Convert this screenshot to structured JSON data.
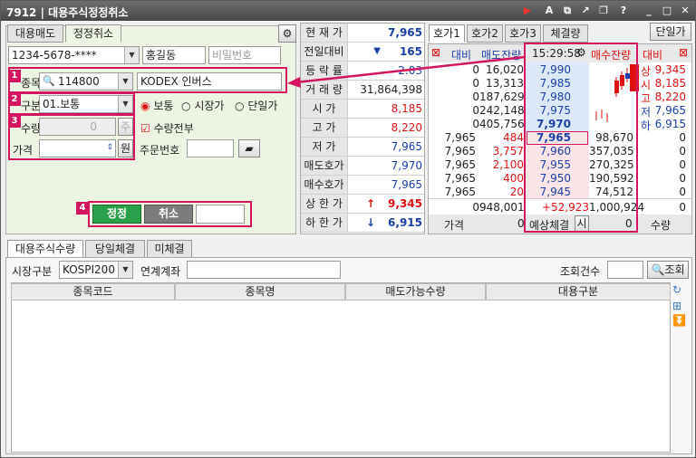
{
  "window": {
    "code": "7912",
    "title": "대용주식정정취소"
  },
  "tabs_left": [
    "대용매도",
    "정정취소"
  ],
  "account": {
    "number": "1234-5678-****",
    "name": "홍길동",
    "password_placeholder": "비밀번호"
  },
  "order": {
    "stock_label": "종목",
    "stock_code": "114800",
    "stock_name": "KODEX 인버스",
    "type_label": "구분",
    "type_value": "01.보통",
    "radios": [
      "보통",
      "시장가",
      "단일가"
    ],
    "qty_label": "수량",
    "qty_value": "0",
    "qty_unit": "주",
    "all_qty_label": "수량전부",
    "price_label": "가격",
    "price_unit": "원",
    "order_no_label": "주문번호",
    "modify_label": "정정",
    "cancel_label": "취소"
  },
  "badges": [
    "1",
    "2",
    "3",
    "4"
  ],
  "quote": [
    {
      "k": "현 재 가",
      "v": "7,965"
    },
    {
      "k": "전일대비",
      "v": "165",
      "arrow": "▼"
    },
    {
      "k": "등 락 률",
      "v": "-2.03"
    },
    {
      "k": "거 래 량",
      "v": "31,864,398"
    },
    {
      "k": "시   가",
      "v": "8,185"
    },
    {
      "k": "고   가",
      "v": "8,220"
    },
    {
      "k": "저   가",
      "v": "7,965"
    },
    {
      "k": "매도호가",
      "v": "7,970"
    },
    {
      "k": "매수호가",
      "v": "7,965"
    },
    {
      "k": "상 한 가",
      "v": "9,345",
      "arrow": "↑"
    },
    {
      "k": "하 한 가",
      "v": "6,915",
      "arrow": "↓"
    }
  ],
  "tabs_right": [
    "호가1",
    "호가2",
    "호가3",
    "체결량"
  ],
  "single_price_btn": "단일가",
  "orderbook": {
    "hdr_left": "대비",
    "hdr_ask": "매도잔량",
    "time": "15:29:58",
    "hdr_bid": "매수잔량",
    "hdr_right": "대비",
    "ask_rows": [
      {
        "a": "0",
        "b": "16,020",
        "p": "7,990"
      },
      {
        "a": "0",
        "b": "13,313",
        "p": "7,985"
      },
      {
        "a": "0",
        "b": "187,629",
        "p": "7,980"
      },
      {
        "a": "0",
        "b": "242,148",
        "p": "7,975"
      },
      {
        "a": "0",
        "b": "405,756",
        "p": "7,970"
      }
    ],
    "bid_rows": [
      {
        "l": "7,965",
        "c": "484",
        "p": "7,965",
        "b": "98,670",
        "r": "0"
      },
      {
        "l": "7,965",
        "c": "3,757",
        "p": "7,960",
        "b": "357,035",
        "r": "0"
      },
      {
        "l": "7,965",
        "c": "2,100",
        "p": "7,955",
        "b": "270,325",
        "r": "0"
      },
      {
        "l": "7,965",
        "c": "400",
        "p": "7,950",
        "b": "190,592",
        "r": "0"
      },
      {
        "l": "7,965",
        "c": "20",
        "p": "7,945",
        "b": "74,512",
        "r": "0"
      }
    ],
    "side_labels": [
      {
        "k": "상",
        "v": "9,345"
      },
      {
        "k": "시",
        "v": "8,185"
      },
      {
        "k": "고",
        "v": "8,220"
      },
      {
        "k": "저",
        "v": "7,965"
      },
      {
        "k": "하",
        "v": "6,915"
      }
    ],
    "tot_left": "0",
    "tot_ask": "948,001",
    "tot_diff": "+52,923",
    "tot_bid": "1,000,924",
    "tot_right": "0",
    "foot_price": "가격",
    "foot_zero": "0",
    "foot_expect": "예상체결",
    "foot_si": "시",
    "foot_zero2": "0",
    "foot_qty": "수량"
  },
  "tabs_bottom": [
    "대용주식수량",
    "당일체결",
    "미체결"
  ],
  "filter": {
    "market_label": "시장구분",
    "market_value": "KOSPI200",
    "link_label": "연계계좌",
    "count_label": "조회건수",
    "search_label": "조회"
  },
  "table_headers": [
    "종목코드",
    "종목명",
    "매도가능수량",
    "대용구분"
  ]
}
